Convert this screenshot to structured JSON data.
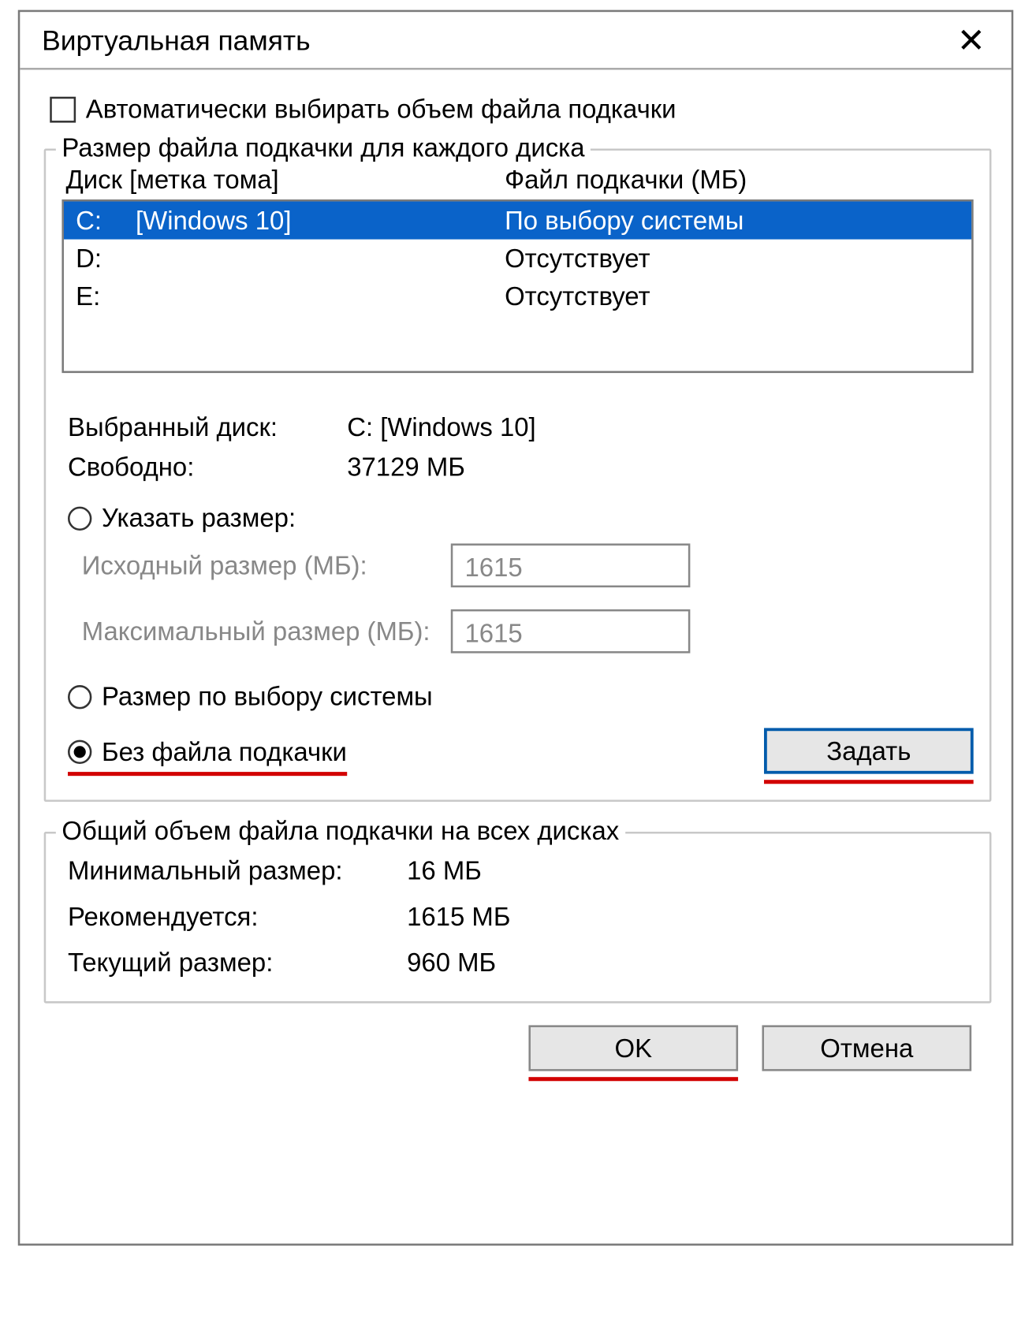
{
  "dialog": {
    "title": "Виртуальная память",
    "auto_checkbox_label": "Автоматически выбирать объем файла подкачки",
    "group1_legend": "Размер файла подкачки для каждого диска",
    "header_drive": "Диск [метка тома]",
    "header_pf": "Файл подкачки (МБ)",
    "drives": [
      {
        "letter": "C:",
        "label": "[Windows 10]",
        "pf": "По выбору системы",
        "selected": true
      },
      {
        "letter": "D:",
        "label": "",
        "pf": "Отсутствует",
        "selected": false
      },
      {
        "letter": "E:",
        "label": "",
        "pf": "Отсутствует",
        "selected": false
      }
    ],
    "selected_drive_label": "Выбранный диск:",
    "selected_drive_value": "C:  [Windows 10]",
    "free_label": "Свободно:",
    "free_value": "37129 МБ",
    "radio_custom": "Указать размер:",
    "initial_label": "Исходный размер (МБ):",
    "initial_value": "1615",
    "max_label": "Максимальный размер (МБ):",
    "max_value": "1615",
    "radio_system": "Размер по выбору системы",
    "radio_none": "Без файла подкачки",
    "set_btn": "Задать",
    "group2_legend": "Общий объем файла подкачки на всех дисках",
    "min_label": "Минимальный размер:",
    "min_value": "16 МБ",
    "rec_label": "Рекомендуется:",
    "rec_value": "1615 МБ",
    "cur_label": "Текущий размер:",
    "cur_value": "960 МБ",
    "ok": "OK",
    "cancel": "Отмена"
  }
}
